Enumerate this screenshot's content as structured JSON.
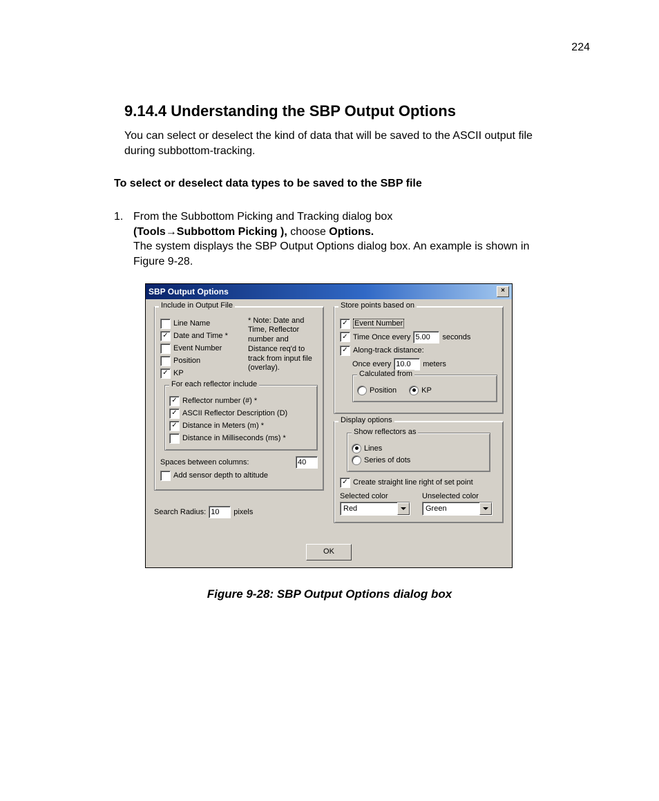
{
  "page_number": "224",
  "heading": "9.14.4    Understanding the SBP Output Options",
  "intro": "You can select or deselect the kind of data that will be saved to the ASCII output file during subbottom-tracking.",
  "instr_heading": "To select or deselect data types to be saved to the SBP file",
  "step1_num": "1.",
  "step1_a": "From the Subbottom Picking and Tracking dialog box ",
  "step1_b": "(Tools→Subbottom Picking ),",
  "step1_c": " choose ",
  "step1_d": "Options.",
  "step1_e": "The system displays the SBP Output Options dialog box. An example is shown in Figure 9-28.",
  "dialog": {
    "title": "SBP Output Options",
    "close": "×",
    "include": {
      "title": "Include in Output File",
      "line_name": "Line Name",
      "date_time": "Date and Time *",
      "event_number": "Event Number",
      "position": "Position",
      "kp": "KP",
      "note": "* Note: Date and Time, Reflector number and Distance req'd to track from input file (overlay).",
      "reflector_group": {
        "title": "For each reflector include",
        "num": "Reflector number (#) *",
        "ascii": "ASCII Reflector Description (D)",
        "meters": "Distance in Meters (m) *",
        "ms": "Distance in Milliseconds (ms) *"
      },
      "spaces_label": "Spaces between columns:",
      "spaces_value": "40",
      "add_sensor": "Add sensor depth to altitude"
    },
    "search_radius_label": "Search Radius:",
    "search_radius_value": "10",
    "search_radius_unit": "pixels",
    "store": {
      "title": "Store points based on",
      "event_number": "Event Number",
      "time_prefix": "Time Once every",
      "time_value": "5.00",
      "time_suffix": "seconds",
      "along": "Along-track distance:",
      "once_prefix": "Once every",
      "once_value": "10.0",
      "once_suffix": "meters",
      "calc_title": "Calculated from",
      "calc_position": "Position",
      "calc_kp": "KP"
    },
    "display": {
      "title": "Display options",
      "show_title": "Show reflectors as",
      "lines": "Lines",
      "dots": "Series of dots",
      "straight": "Create straight line right of set point",
      "selected_label": "Selected color",
      "unselected_label": "Unselected color",
      "selected_value": "Red",
      "unselected_value": "Green"
    },
    "ok": "OK"
  },
  "figure_caption": "Figure 9-28: SBP Output Options dialog box"
}
